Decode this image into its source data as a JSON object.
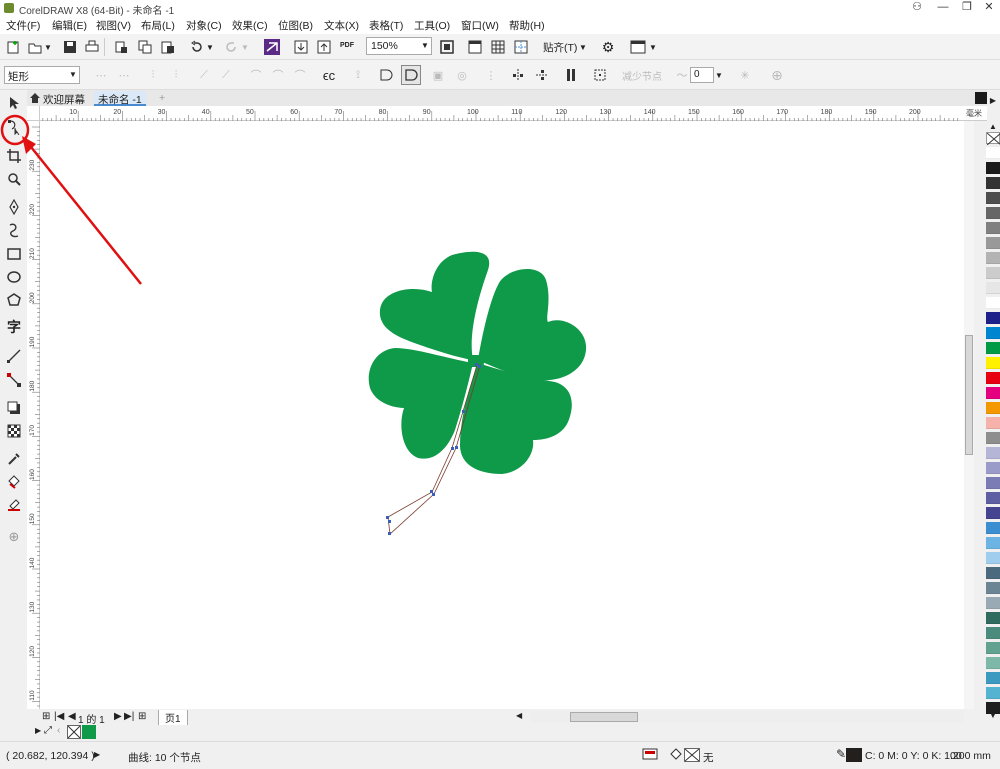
{
  "window": {
    "title": "CorelDRAW X8 (64-Bit) - 未命名 -1"
  },
  "menu": [
    "文件(F)",
    "编辑(E)",
    "视图(V)",
    "布局(L)",
    "对象(C)",
    "效果(C)",
    "位图(B)",
    "文本(X)",
    "表格(T)",
    "工具(O)",
    "窗口(W)",
    "帮助(H)"
  ],
  "toolbar": {
    "zoom_value": "150%",
    "snap_label": "贴齐(T)",
    "pdf_label": "PDF"
  },
  "propertybar": {
    "shape_type": "矩形",
    "reduce_nodes_label": "减少节点",
    "smoothing_value": "0"
  },
  "tabs": {
    "welcome": "欢迎屏幕",
    "document": "未命名 -1"
  },
  "ruler": {
    "h_labels": [
      "10",
      "20",
      "30",
      "40",
      "50",
      "60",
      "70",
      "80",
      "90",
      "100",
      "110",
      "120",
      "130",
      "140",
      "150",
      "160",
      "170",
      "180",
      "190",
      "200"
    ],
    "v_labels": [
      "230",
      "220",
      "210",
      "200",
      "190",
      "180",
      "170",
      "160",
      "150",
      "140",
      "130",
      "120",
      "110"
    ],
    "units": "毫米"
  },
  "pagenav": {
    "page_count": "1 的 1",
    "page_tab": "页1"
  },
  "status": {
    "coords": "( 20.682, 120.394 )",
    "selection": "曲线: 10 个节点",
    "fill_none": "无",
    "outline_color": "C: 0 M: 0 Y: 0 K: 100",
    "outline_width": ".200 mm"
  },
  "colors": {
    "clover": "#0e9a48",
    "node_line": "#7a3b2e",
    "node": "#3a5fb8",
    "annotation": "#e01010",
    "outline_swatch": "#231f1c"
  },
  "palette": [
    "#ffffff",
    "#1a1a1a",
    "#333333",
    "#4d4d4d",
    "#666666",
    "#808080",
    "#999999",
    "#b3b3b3",
    "#cccccc",
    "#e6e6e6",
    "#ffffff",
    "#1d2088",
    "#0085d0",
    "#009944",
    "#fff100",
    "#e60012",
    "#e4007f",
    "#f39800",
    "#f5b1aa",
    "#8e8e8e",
    "#b5b5d8",
    "#9b9bc9",
    "#7b7bb6",
    "#5e5ea3",
    "#444490",
    "#3b8fd0",
    "#6cb4e4",
    "#a0cdee",
    "#4c6a7e",
    "#6b8595",
    "#9aaab4",
    "#2f6b5e",
    "#4b8b7d",
    "#63a190",
    "#7db8a8",
    "#3c9ac0",
    "#55b3d2",
    "#1e1e1e"
  ]
}
